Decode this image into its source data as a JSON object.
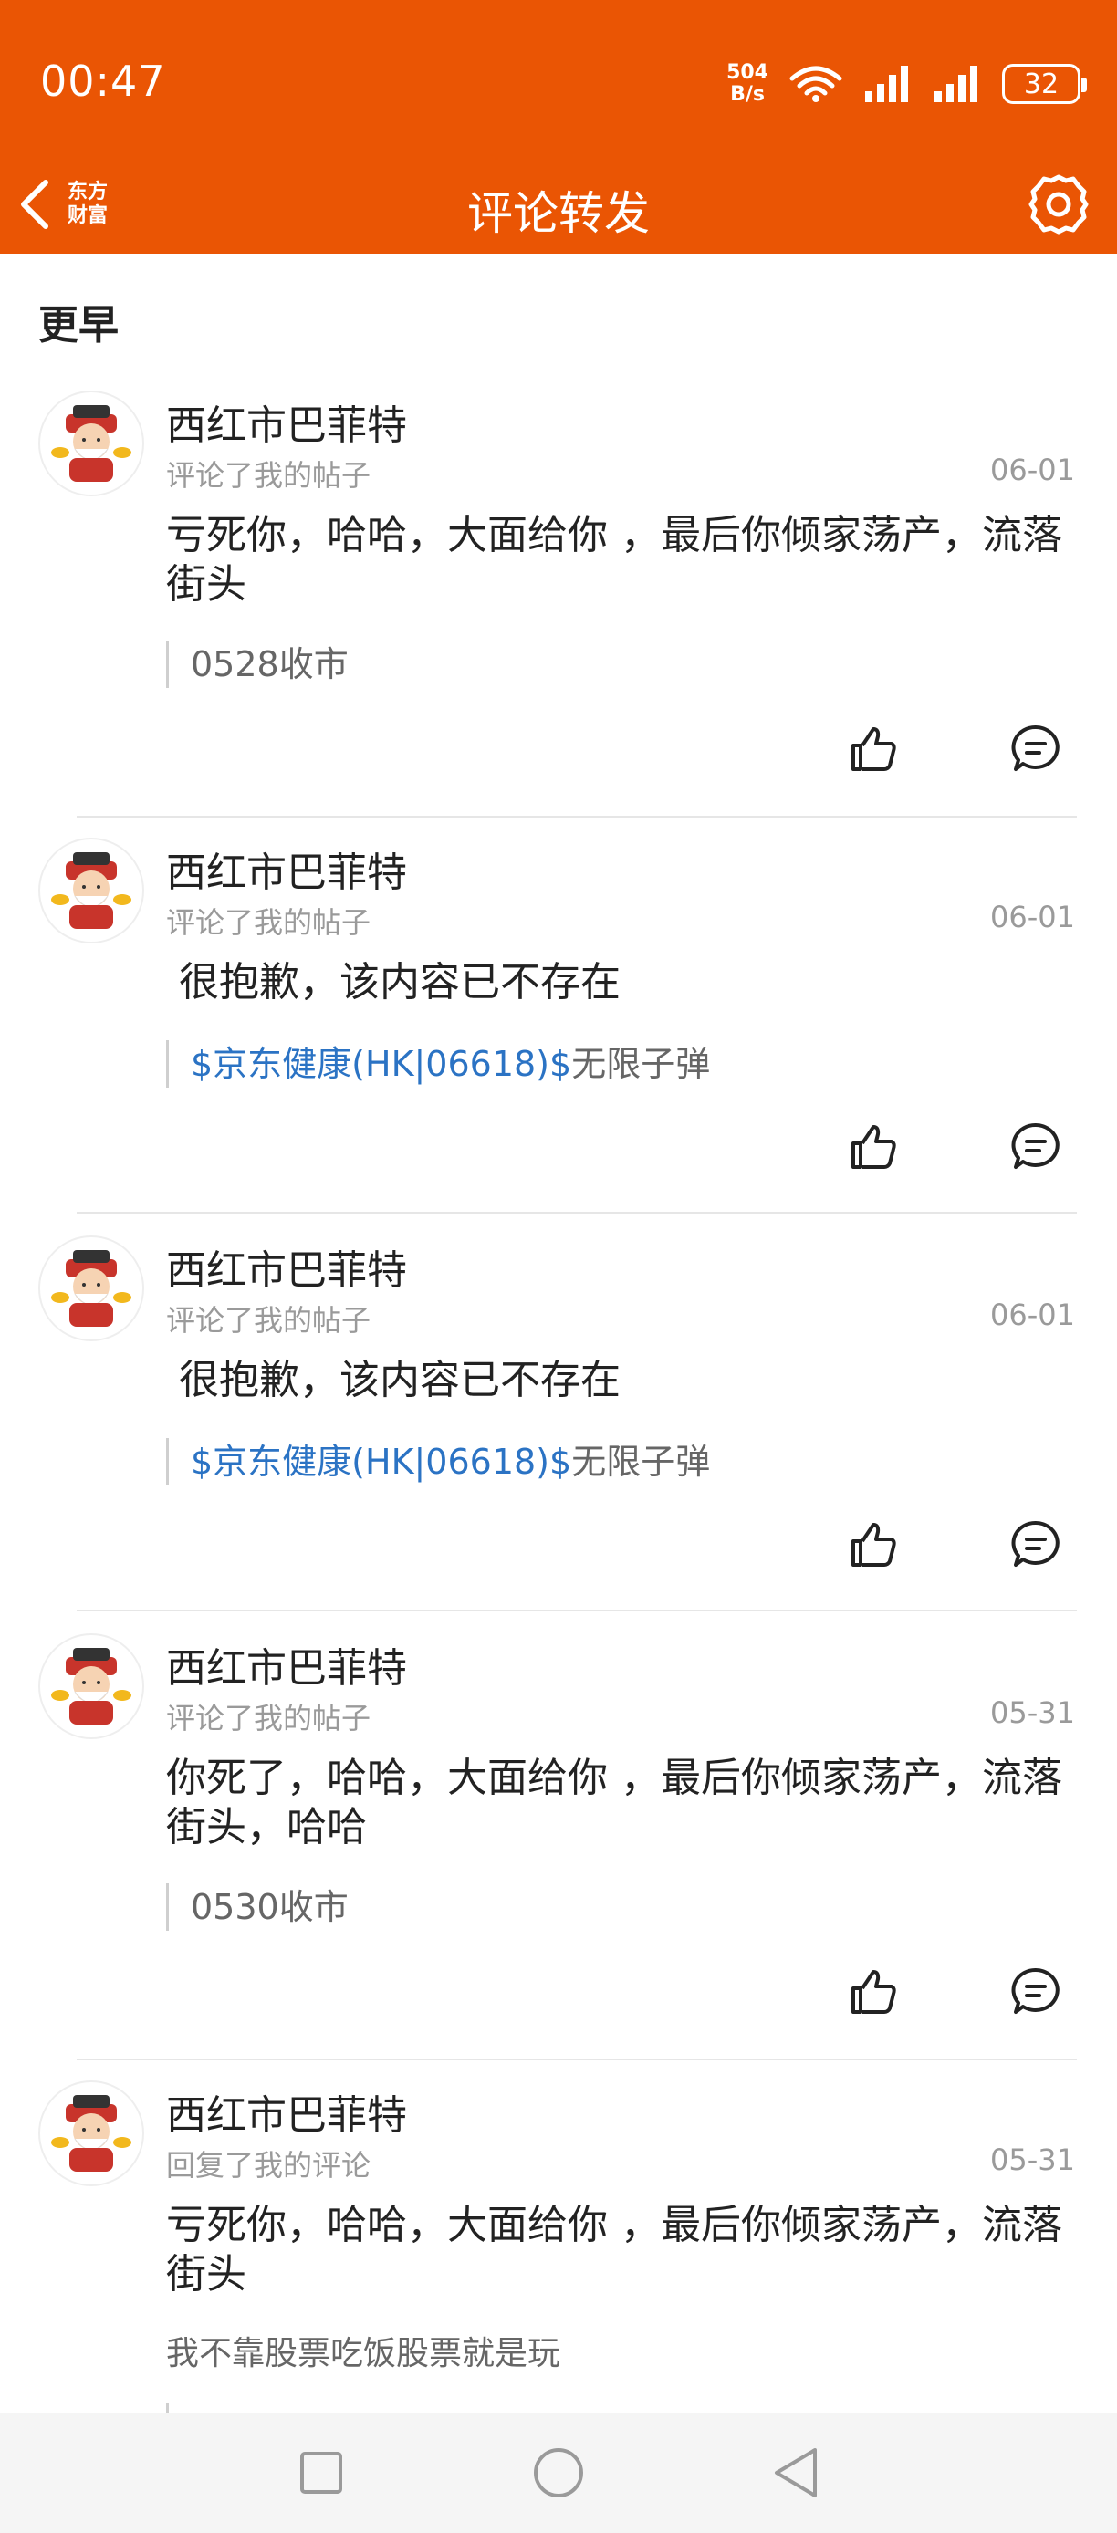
{
  "status": {
    "time": "00:47",
    "net_speed_value": "504",
    "net_speed_unit": "B/s",
    "battery": "32"
  },
  "nav": {
    "title": "评论转发",
    "logo_line1": "东方",
    "logo_line2": "财富"
  },
  "section": {
    "heading": "更早"
  },
  "items": [
    {
      "user": "西红市巴菲特",
      "action": "评论了我的帖子",
      "date": "06-01",
      "text": "亏死你，哈哈，大面给你 ，最后你倾家荡产，流落街头",
      "quote_link": "",
      "quote_text": "0528收市"
    },
    {
      "user": "西红市巴菲特",
      "action": "评论了我的帖子",
      "date": "06-01",
      "text": " 很抱歉，该内容已不存在",
      "quote_link": "$京东健康(HK|06618)$",
      "quote_text": "无限子弹"
    },
    {
      "user": "西红市巴菲特",
      "action": "评论了我的帖子",
      "date": "06-01",
      "text": " 很抱歉，该内容已不存在",
      "quote_link": "$京东健康(HK|06618)$",
      "quote_text": "无限子弹"
    },
    {
      "user": "西红市巴菲特",
      "action": "评论了我的帖子",
      "date": "05-31",
      "text": "你死了，哈哈，大面给你 ，最后你倾家荡产，流落街头，哈哈",
      "quote_link": "",
      "quote_text": "0530收市"
    },
    {
      "user": "西红市巴菲特",
      "action": "回复了我的评论",
      "date": "05-31",
      "text": "亏死你，哈哈，大面给你 ，最后你倾家荡产，流落街头",
      "reply": "我不靠股票吃饭股票就是玩"
    }
  ],
  "colors": {
    "brand": "#ea5504",
    "link": "#2b73c4"
  },
  "icons": {
    "back": "chevron-left-icon",
    "settings": "gear-icon",
    "like": "thumbs-up-icon",
    "comment": "comment-icon"
  }
}
